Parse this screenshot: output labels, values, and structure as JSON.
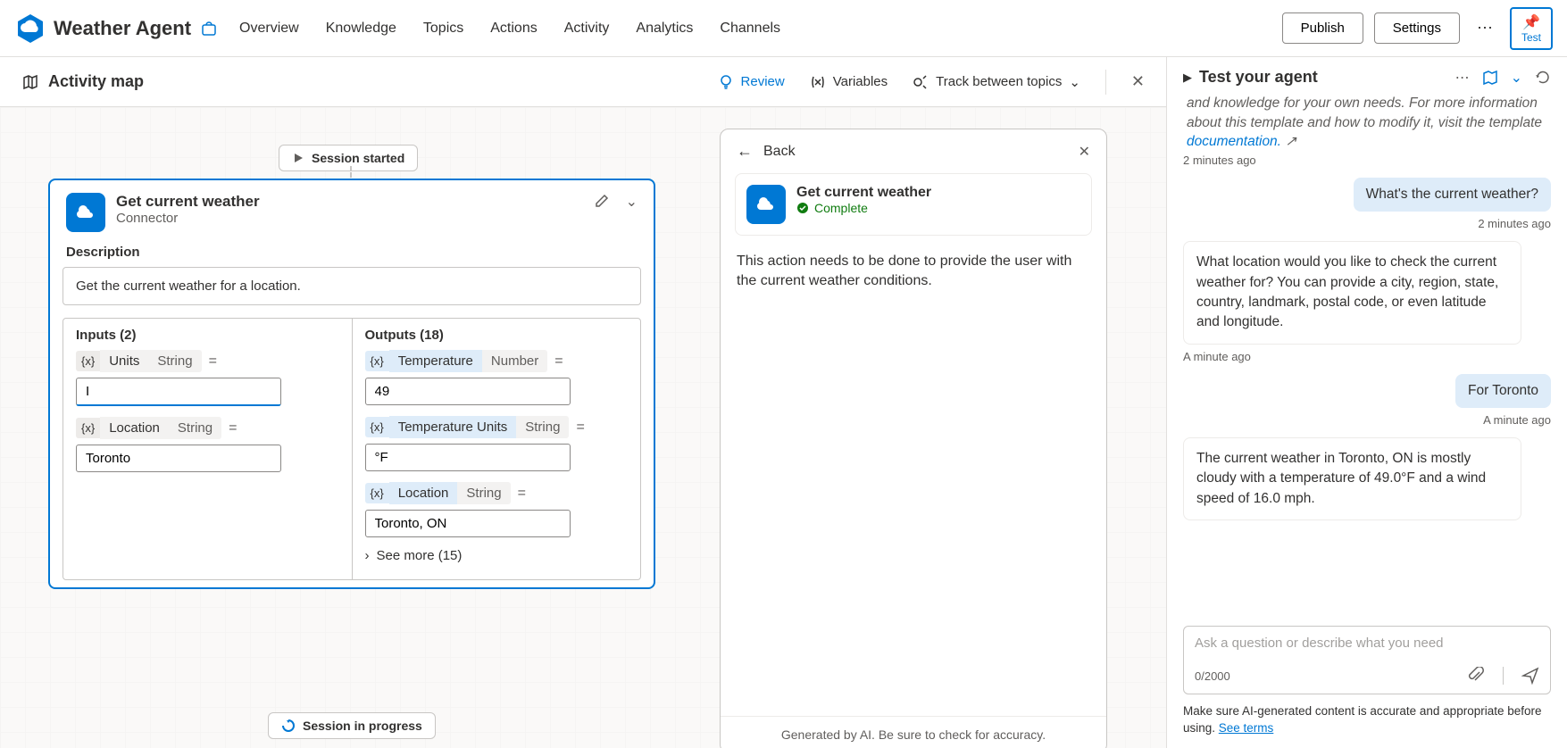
{
  "app": {
    "title": "Weather Agent",
    "test_label": "Test"
  },
  "nav": {
    "overview": "Overview",
    "knowledge": "Knowledge",
    "topics": "Topics",
    "actions": "Actions",
    "activity": "Activity",
    "analytics": "Analytics",
    "channels": "Channels"
  },
  "header_buttons": {
    "publish": "Publish",
    "settings": "Settings"
  },
  "canvas": {
    "title": "Activity map",
    "review": "Review",
    "variables": "Variables",
    "track": "Track between topics",
    "session_started": "Session started",
    "session_progress": "Session in progress"
  },
  "connector": {
    "title": "Get current weather",
    "subtitle": "Connector",
    "desc_label": "Description",
    "description": "Get the current weather for a location.",
    "inputs_label": "Inputs (2)",
    "outputs_label": "Outputs (18)",
    "see_more": "See more (15)",
    "inputs": [
      {
        "name": "Units",
        "type": "String",
        "value": "I"
      },
      {
        "name": "Location",
        "type": "String",
        "value": "Toronto"
      }
    ],
    "outputs": [
      {
        "name": "Temperature",
        "type": "Number",
        "value": "49"
      },
      {
        "name": "Temperature Units",
        "type": "String",
        "value": "°F"
      },
      {
        "name": "Location",
        "type": "String",
        "value": "Toronto, ON"
      }
    ]
  },
  "detail": {
    "back": "Back",
    "title": "Get current weather",
    "status": "Complete",
    "note": "This action needs to be done to provide the user with the current weather conditions.",
    "footer": "Generated by AI. Be sure to check for accuracy."
  },
  "test": {
    "title": "Test your agent",
    "intro": "and knowledge for your own needs. For more information about this template and how to modify it, visit the template ",
    "intro_link": "documentation.",
    "ts1": "2 minutes ago",
    "user1": "What's the current weather?",
    "ts2": "2 minutes ago",
    "bot1": "What location would you like to check the current weather for? You can provide a city, region, state, country, landmark, postal code, or even latitude and longitude.",
    "ts3": "A minute ago",
    "user2": "For Toronto",
    "ts4": "A minute ago",
    "bot2": "The current weather in Toronto, ON is mostly cloudy with a temperature of 49.0°F and a wind speed of 16.0 mph.",
    "placeholder": "Ask a question or describe what you need",
    "counter": "0/2000",
    "disclaimer": "Make sure AI-generated content is accurate and appropriate before using. ",
    "disclaimer_link": "See terms"
  }
}
